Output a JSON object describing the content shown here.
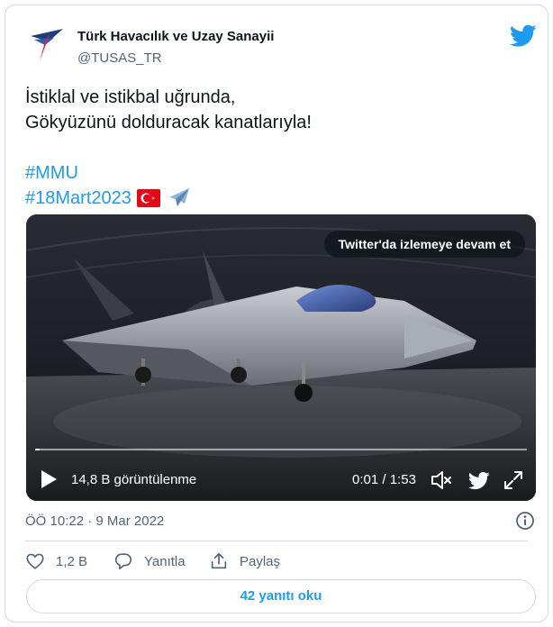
{
  "author": {
    "name": "Türk Havacılık ve Uzay Sanayii",
    "handle": "@TUSAS_TR"
  },
  "tweet": {
    "line1": "İstiklal ve istikbal uğrunda,",
    "line2": "Gökyüzünü dolduracak kanatlarıyla!",
    "hashtag1": "#MMU",
    "hashtag2": "#18Mart2023",
    "emojis": [
      "turkey-flag",
      "airplane"
    ]
  },
  "video": {
    "watch_on_twitter": "Twitter'da izlemeye devam et",
    "views": "14,8 B görüntülenme",
    "elapsed": "0:01",
    "separator": "/",
    "duration": "1:53",
    "progress": 0.009
  },
  "meta": {
    "timestamp": "ÖÖ 10:22 · 9 Mar 2022"
  },
  "actions": {
    "like_count": "1,2 B",
    "reply_label": "Yanıtla",
    "share_label": "Paylaş",
    "read_replies": "42 yanıtı oku"
  },
  "colors": {
    "accent": "#1d9bf0",
    "text": "#0f1419",
    "muted": "#536471",
    "border": "#cfd9de"
  }
}
